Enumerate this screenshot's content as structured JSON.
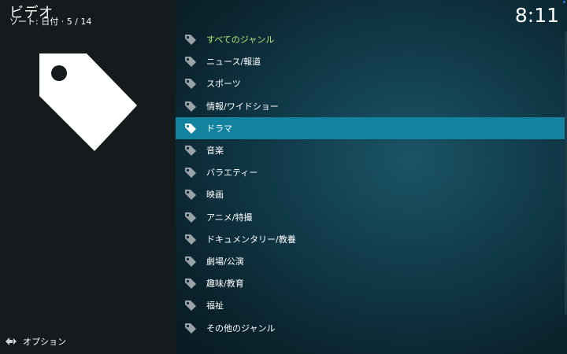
{
  "header": {
    "title": "ビデオ",
    "sort_info": "ソート: 日付 · 5 / 14"
  },
  "clock": "8:11",
  "genres": [
    {
      "label": "すべてのジャンル",
      "accent": true,
      "selected": false
    },
    {
      "label": "ニュース/報道",
      "accent": false,
      "selected": false
    },
    {
      "label": "スポーツ",
      "accent": false,
      "selected": false
    },
    {
      "label": "情報/ワイドショー",
      "accent": false,
      "selected": false
    },
    {
      "label": "ドラマ",
      "accent": false,
      "selected": true
    },
    {
      "label": "音楽",
      "accent": false,
      "selected": false
    },
    {
      "label": "バラエティー",
      "accent": false,
      "selected": false
    },
    {
      "label": "映画",
      "accent": false,
      "selected": false
    },
    {
      "label": "アニメ/特撮",
      "accent": false,
      "selected": false
    },
    {
      "label": "ドキュメンタリー/教養",
      "accent": false,
      "selected": false
    },
    {
      "label": "劇場/公演",
      "accent": false,
      "selected": false
    },
    {
      "label": "趣味/教育",
      "accent": false,
      "selected": false
    },
    {
      "label": "福祉",
      "accent": false,
      "selected": false
    },
    {
      "label": "その他のジャンル",
      "accent": false,
      "selected": false
    }
  ],
  "footer": {
    "options_label": "オプション"
  },
  "icons": {
    "genre_icon": "tag-icon",
    "preview_icon": "tag-icon",
    "options_icon": "options-arrows-icon"
  },
  "colors": {
    "selected_bg": "#12829f",
    "accent_text": "#b5e87a"
  }
}
